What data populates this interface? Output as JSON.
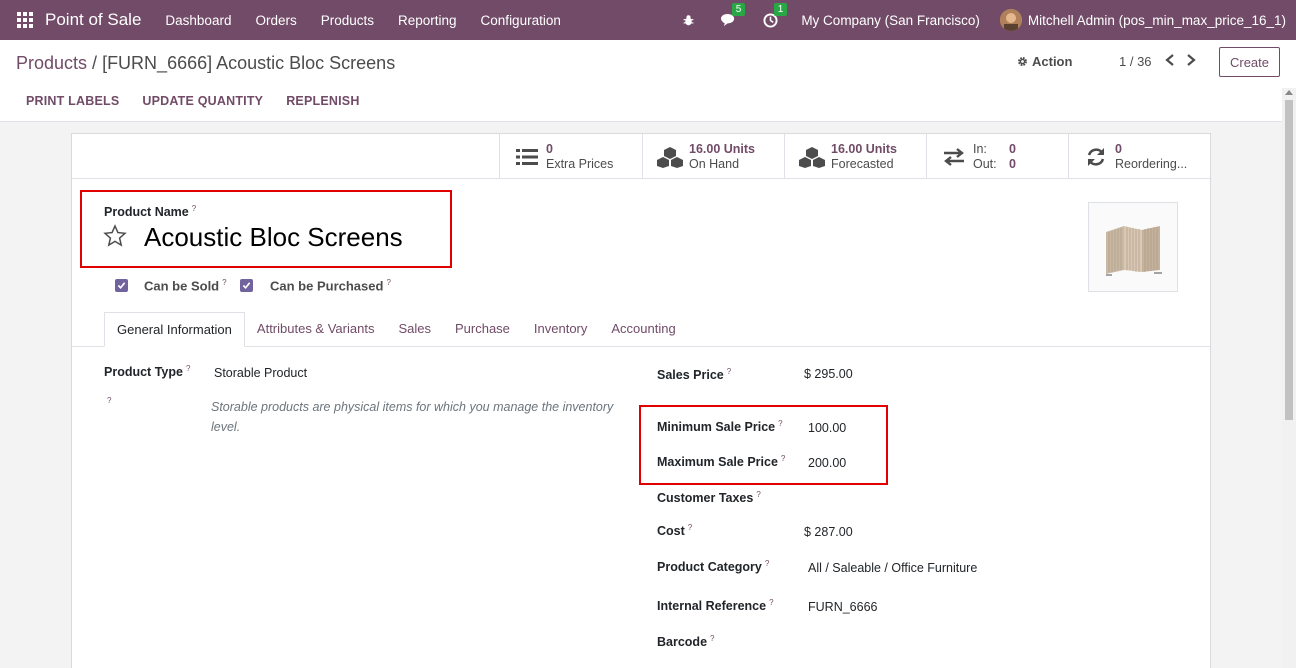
{
  "navbar": {
    "app_name": "Point of Sale",
    "menu": [
      "Dashboard",
      "Orders",
      "Products",
      "Reporting",
      "Configuration"
    ],
    "messages_count": "5",
    "activities_count": "1",
    "company": "My Company (San Francisco)",
    "user": "Mitchell Admin (pos_min_max_price_16_1)"
  },
  "control": {
    "breadcrumb_parent": "Products",
    "breadcrumb_sep": " / ",
    "breadcrumb_current": "[FURN_6666] Acoustic Bloc Screens",
    "action_label": "Action",
    "pager": "1 / 36",
    "create_label": "Create",
    "actions": [
      "PRINT LABELS",
      "UPDATE QUANTITY",
      "REPLENISH"
    ]
  },
  "stats": {
    "extra_prices_value": "0",
    "extra_prices_label": "Extra Prices",
    "on_hand_value": "16.00 Units",
    "on_hand_label": "On Hand",
    "forecasted_value": "16.00 Units",
    "forecasted_label": "Forecasted",
    "in_label": "In:",
    "in_value": "0",
    "out_label": "Out:",
    "out_value": "0",
    "reordering_value": "0",
    "reordering_label": "Reordering..."
  },
  "product": {
    "name_label": "Product Name",
    "name": "Acoustic Bloc Screens",
    "can_be_sold_label": "Can be Sold",
    "can_be_purchased_label": "Can be Purchased"
  },
  "tabs": [
    "General Information",
    "Attributes & Variants",
    "Sales",
    "Purchase",
    "Inventory",
    "Accounting"
  ],
  "general": {
    "product_type_label": "Product Type",
    "product_type_value": "Storable Product",
    "product_type_help": "Storable products are physical items for which you manage the inventory level.",
    "sales_price_label": "Sales Price",
    "sales_price_value": "$ 295.00",
    "min_price_label": "Minimum Sale Price",
    "min_price_value": "100.00",
    "max_price_label": "Maximum Sale Price",
    "max_price_value": "200.00",
    "customer_taxes_label": "Customer Taxes",
    "cost_label": "Cost",
    "cost_value": "$ 287.00",
    "category_label": "Product Category",
    "category_value": "All / Saleable / Office Furniture",
    "internal_ref_label": "Internal Reference",
    "internal_ref_value": "FURN_6666",
    "barcode_label": "Barcode"
  },
  "colors": {
    "brand": "#714b67",
    "annotation": "#e00000",
    "checkbox": "#71639e"
  }
}
